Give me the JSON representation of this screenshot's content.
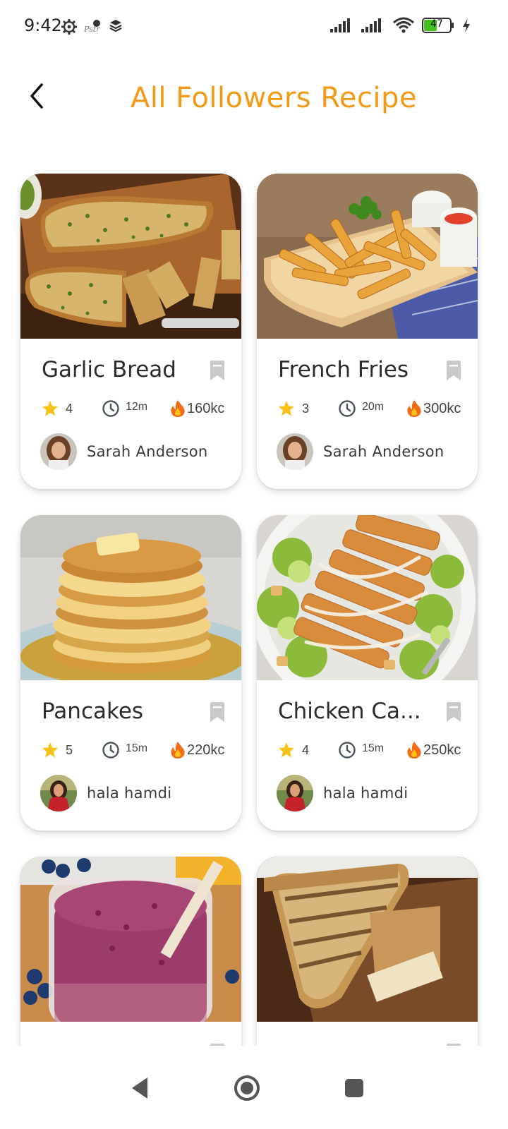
{
  "status_bar": {
    "time": "9:42",
    "battery": "47",
    "icons": [
      "settings-gear-icon",
      "app-notification-icon",
      "layers-icon",
      "signal-icon",
      "signal-icon",
      "wifi-icon",
      "battery-icon",
      "charging-bolt-icon"
    ]
  },
  "header": {
    "back_icon": "chevron-left-icon",
    "title": "All Followers Recipe"
  },
  "colors": {
    "accent": "#f29a16",
    "star": "#f6c21a",
    "bookmark": "#c9c9c9",
    "text": "#2b2b2b"
  },
  "recipes": [
    {
      "title": "Garlic Bread",
      "rating": "4",
      "time": "12m",
      "calories": "160kc",
      "author": "Sarah Anderson",
      "bookmark_icon": "bookmark-icon"
    },
    {
      "title": "French Fries",
      "rating": "3",
      "time": "20m",
      "calories": "300kc",
      "author": "Sarah Anderson",
      "bookmark_icon": "bookmark-icon"
    },
    {
      "title": "Pancakes",
      "rating": "5",
      "time": "15m",
      "calories": "220kc",
      "author": "hala hamdi",
      "bookmark_icon": "bookmark-icon"
    },
    {
      "title": "Chicken Ca...",
      "rating": "4",
      "time": "15m",
      "calories": "250kc",
      "author": "hala hamdi",
      "bookmark_icon": "bookmark-icon"
    },
    {
      "title": "",
      "rating": "",
      "time": "",
      "calories": "",
      "author": "",
      "bookmark_icon": "bookmark-icon"
    },
    {
      "title": "",
      "rating": "",
      "time": "",
      "calories": "",
      "author": "",
      "bookmark_icon": "bookmark-icon"
    }
  ],
  "nav_bar": {
    "icons": [
      "back-triangle-icon",
      "home-circle-icon",
      "recents-square-icon"
    ]
  }
}
